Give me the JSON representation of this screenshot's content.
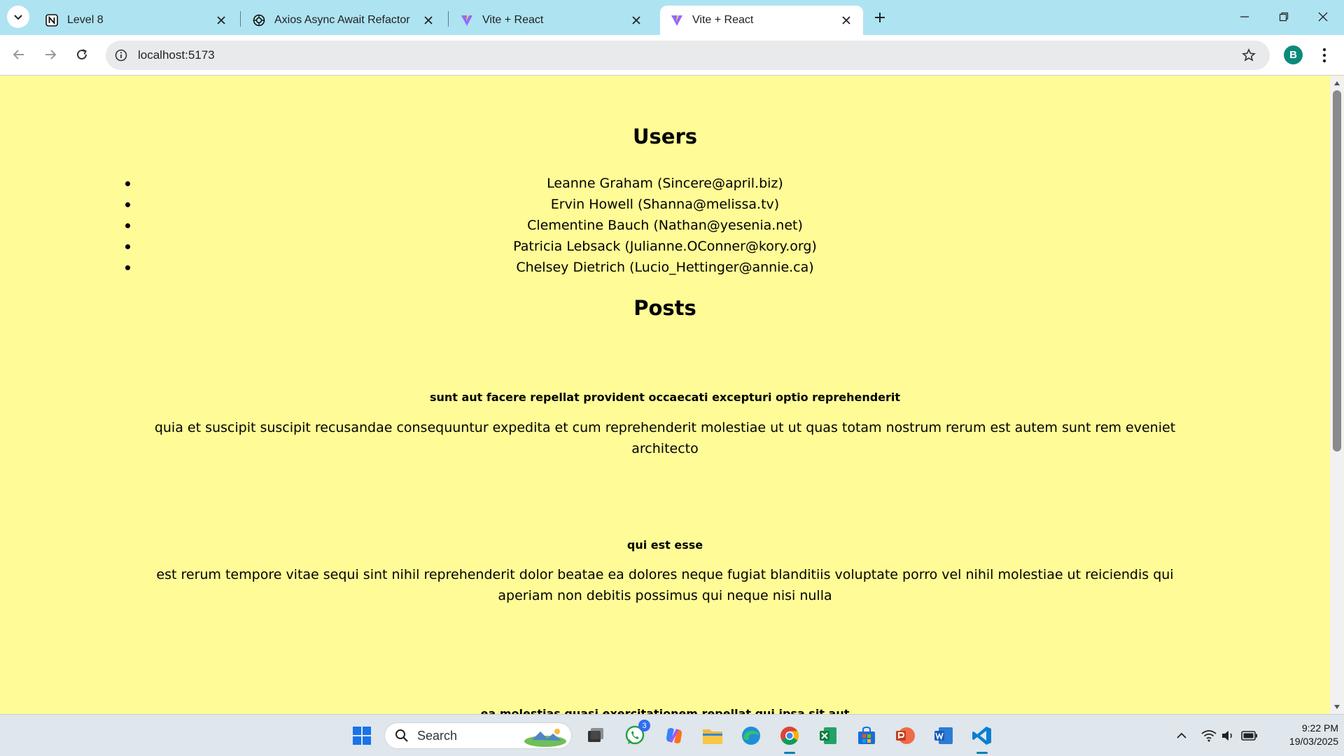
{
  "browser": {
    "tabs": [
      {
        "title": "Level 8",
        "icon": "notion-icon",
        "active": false
      },
      {
        "title": "Axios Async Await Refactor",
        "icon": "openai-icon",
        "active": false
      },
      {
        "title": "Vite + React",
        "icon": "vite-icon",
        "active": false
      },
      {
        "title": "Vite + React",
        "icon": "vite-icon",
        "active": true
      }
    ],
    "url": "localhost:5173",
    "profile_initial": "B"
  },
  "page": {
    "users_heading": "Users",
    "users": [
      "Leanne Graham (Sincere@april.biz)",
      "Ervin Howell (Shanna@melissa.tv)",
      "Clementine Bauch (Nathan@yesenia.net)",
      "Patricia Lebsack (Julianne.OConner@kory.org)",
      "Chelsey Dietrich (Lucio_Hettinger@annie.ca)"
    ],
    "posts_heading": "Posts",
    "posts": [
      {
        "title": "sunt aut facere repellat provident occaecati excepturi optio reprehenderit",
        "body": "quia et suscipit suscipit recusandae consequuntur expedita et cum reprehenderit molestiae ut ut quas totam nostrum rerum est autem sunt rem eveniet architecto"
      },
      {
        "title": "qui est esse",
        "body": "est rerum tempore vitae sequi sint nihil reprehenderit dolor beatae ea dolores neque fugiat blanditiis voluptate porro vel nihil molestiae ut reiciendis qui aperiam non debitis possimus qui neque nisi nulla"
      },
      {
        "title": "ea molestias quasi exercitationem repellat qui ipsa sit aut",
        "body": ""
      }
    ],
    "background_color": "#fffb96"
  },
  "taskbar": {
    "search_label": "Search",
    "apps": [
      {
        "name": "start-icon"
      },
      {
        "name": "task-view-icon"
      },
      {
        "name": "whatsapp-icon",
        "badge": "3"
      },
      {
        "name": "copilot-icon"
      },
      {
        "name": "file-explorer-icon"
      },
      {
        "name": "edge-icon"
      },
      {
        "name": "chrome-icon",
        "active": true
      },
      {
        "name": "excel-icon"
      },
      {
        "name": "microsoft-store-icon"
      },
      {
        "name": "powerpoint-icon"
      },
      {
        "name": "word-icon"
      },
      {
        "name": "vscode-icon",
        "active": true
      }
    ],
    "time": "9:22 PM",
    "date": "19/03/2025"
  }
}
